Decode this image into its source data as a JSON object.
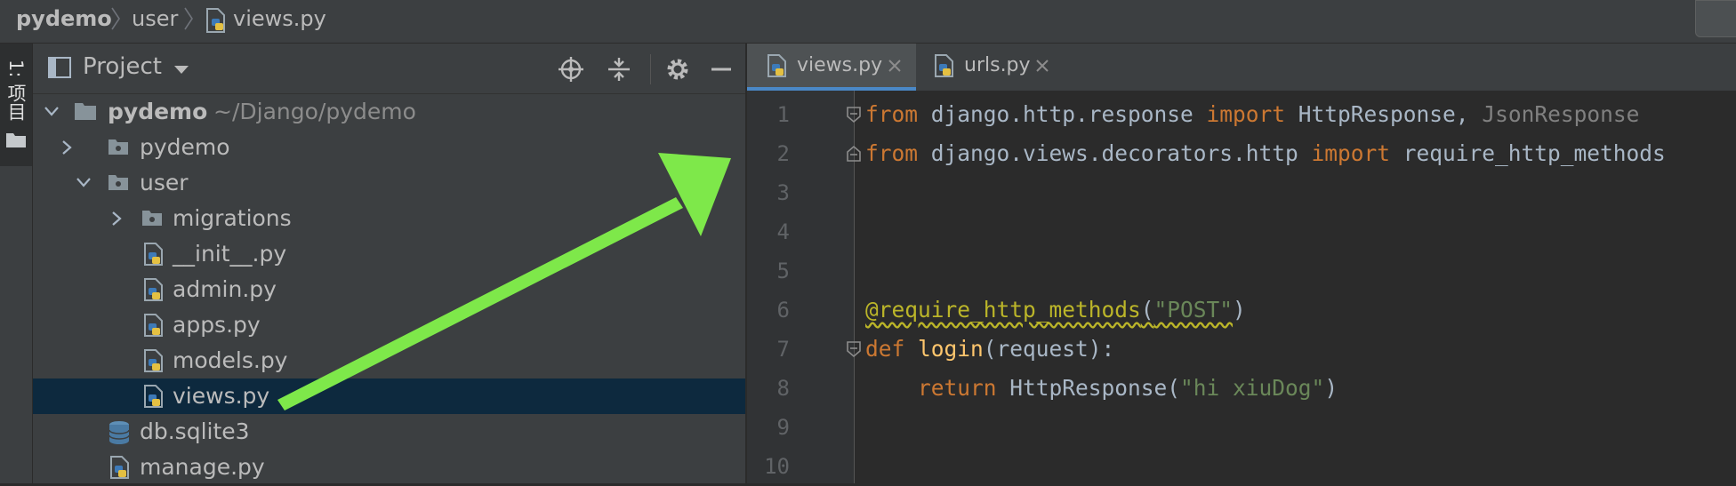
{
  "breadcrumb": [
    "pydemo",
    "user",
    "views.py"
  ],
  "left_strip": {
    "project_tab_label": "1: 项目"
  },
  "project_panel": {
    "title": "Project",
    "tree": [
      {
        "name": "pydemo",
        "path_hint": "~/Django/pydemo",
        "type": "root-folder",
        "expanded": true
      },
      {
        "name": "pydemo",
        "type": "folder",
        "expanded": false
      },
      {
        "name": "user",
        "type": "folder",
        "expanded": true
      },
      {
        "name": "migrations",
        "type": "folder",
        "expanded": false
      },
      {
        "name": "__init__.py",
        "type": "python-file"
      },
      {
        "name": "admin.py",
        "type": "python-file"
      },
      {
        "name": "apps.py",
        "type": "python-file"
      },
      {
        "name": "models.py",
        "type": "python-file"
      },
      {
        "name": "views.py",
        "type": "python-file",
        "selected": true
      },
      {
        "name": "db.sqlite3",
        "type": "database-file"
      },
      {
        "name": "manage.py",
        "type": "python-file"
      }
    ]
  },
  "editor": {
    "tabs": [
      {
        "label": "views.py",
        "active": true
      },
      {
        "label": "urls.py",
        "active": false
      }
    ],
    "line_numbers": [
      "1",
      "2",
      "3",
      "4",
      "5",
      "6",
      "7",
      "8",
      "9",
      "10"
    ],
    "lines": {
      "l1": {
        "kw1": "from",
        "mod": " django.http.response ",
        "kw2": "import",
        "names": " HttpResponse,",
        "unused": " JsonResponse"
      },
      "l2": {
        "kw1": "from",
        "mod": " django.views.decorators.http ",
        "kw2": "import",
        "names": " require_http_methods"
      },
      "l6": {
        "dec": "@require_http_methods",
        "open": "(",
        "str": "\"POST\"",
        "close": ")"
      },
      "l7": {
        "kw": "def",
        "sp": " ",
        "fn": "login",
        "rest": "(request):"
      },
      "l8": {
        "indent": "    ",
        "kw": "return",
        "mid": " HttpResponse(",
        "str": "\"hi xiuDog\"",
        "close": ")"
      }
    }
  },
  "colors": {
    "arrow": "#7ee84a",
    "selection": "#0d293e",
    "tab_underline": "#4a88c7"
  }
}
